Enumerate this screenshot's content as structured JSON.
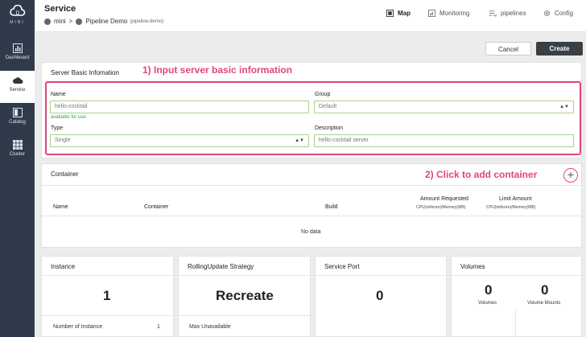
{
  "sidebar": {
    "logo_text": "MINI",
    "items": [
      {
        "label": "Dashboard"
      },
      {
        "label": "Service"
      },
      {
        "label": "Catalog"
      },
      {
        "label": "Cluster"
      }
    ]
  },
  "header": {
    "title": "Service",
    "breadcrumb": {
      "root": "mini",
      "separator": ">",
      "current": "Pipeline Demo",
      "sub": "(pipeline-demo)"
    },
    "nav": [
      {
        "label": "Map",
        "icon": "map-icon"
      },
      {
        "label": "Monitoring",
        "icon": "monitoring-icon"
      },
      {
        "label": "pipelines",
        "icon": "pipelines-icon"
      },
      {
        "label": "Config",
        "icon": "gear-icon"
      }
    ]
  },
  "actions": {
    "cancel": "Cancel",
    "create": "Create"
  },
  "server_info": {
    "title": "Server Basic Infomation",
    "name_label": "Name",
    "name_value": "hello-cocktail",
    "name_hint": "available for use",
    "group_label": "Group",
    "group_value": "Default",
    "type_label": "Type",
    "type_value": "Single",
    "description_label": "Description",
    "description_value": "hello-cocktail server"
  },
  "annotations": {
    "step1": "1) Input server basic information",
    "step2": "2) Click to add container"
  },
  "container": {
    "title": "Container",
    "add_symbol": "+",
    "columns": {
      "name": "Name",
      "container": "Container",
      "build": "Build",
      "amount_requested": "Amount Requested",
      "amount_requested_sub": "CPU(milicore)/Memory(MB)",
      "limit_amount": "Limit Amount",
      "limit_amount_sub": "CPU(milicore)/Memory(MB)"
    },
    "empty": "No data"
  },
  "instance": {
    "title": "Instance",
    "value": "1",
    "row_label": "Number of Instance",
    "row_value": "1"
  },
  "rolling": {
    "title": "RollingUpdate Strategy",
    "value": "Recreate",
    "row_label": "Max Unavailable"
  },
  "service_port": {
    "title": "Service Port",
    "value": "0"
  },
  "volumes": {
    "title": "Volumes",
    "volumes_value": "0",
    "volumes_label": "Volumes",
    "mounts_value": "0",
    "mounts_label": "Volume Mounts"
  },
  "colors": {
    "accent": "#e0457b",
    "sidebar": "#2f3a4a",
    "valid_border": "#a7d28a",
    "valid_text": "#35a04a",
    "primary_button": "#3a3f46"
  }
}
